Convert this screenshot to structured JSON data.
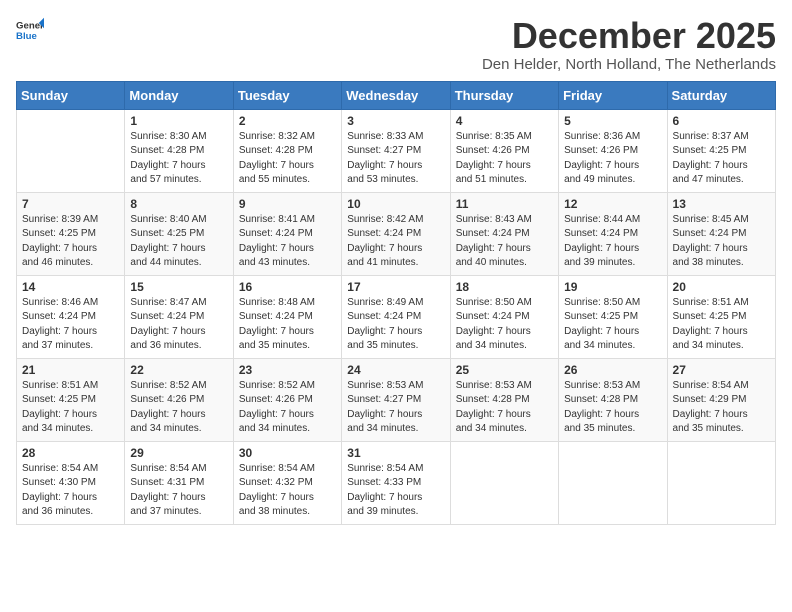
{
  "header": {
    "logo": {
      "general": "General",
      "blue": "Blue"
    },
    "title": "December 2025",
    "location": "Den Helder, North Holland, The Netherlands"
  },
  "calendar": {
    "days_of_week": [
      "Sunday",
      "Monday",
      "Tuesday",
      "Wednesday",
      "Thursday",
      "Friday",
      "Saturday"
    ],
    "weeks": [
      [
        {
          "day": "",
          "info": ""
        },
        {
          "day": "1",
          "info": "Sunrise: 8:30 AM\nSunset: 4:28 PM\nDaylight: 7 hours\nand 57 minutes."
        },
        {
          "day": "2",
          "info": "Sunrise: 8:32 AM\nSunset: 4:28 PM\nDaylight: 7 hours\nand 55 minutes."
        },
        {
          "day": "3",
          "info": "Sunrise: 8:33 AM\nSunset: 4:27 PM\nDaylight: 7 hours\nand 53 minutes."
        },
        {
          "day": "4",
          "info": "Sunrise: 8:35 AM\nSunset: 4:26 PM\nDaylight: 7 hours\nand 51 minutes."
        },
        {
          "day": "5",
          "info": "Sunrise: 8:36 AM\nSunset: 4:26 PM\nDaylight: 7 hours\nand 49 minutes."
        },
        {
          "day": "6",
          "info": "Sunrise: 8:37 AM\nSunset: 4:25 PM\nDaylight: 7 hours\nand 47 minutes."
        }
      ],
      [
        {
          "day": "7",
          "info": "Sunrise: 8:39 AM\nSunset: 4:25 PM\nDaylight: 7 hours\nand 46 minutes."
        },
        {
          "day": "8",
          "info": "Sunrise: 8:40 AM\nSunset: 4:25 PM\nDaylight: 7 hours\nand 44 minutes."
        },
        {
          "day": "9",
          "info": "Sunrise: 8:41 AM\nSunset: 4:24 PM\nDaylight: 7 hours\nand 43 minutes."
        },
        {
          "day": "10",
          "info": "Sunrise: 8:42 AM\nSunset: 4:24 PM\nDaylight: 7 hours\nand 41 minutes."
        },
        {
          "day": "11",
          "info": "Sunrise: 8:43 AM\nSunset: 4:24 PM\nDaylight: 7 hours\nand 40 minutes."
        },
        {
          "day": "12",
          "info": "Sunrise: 8:44 AM\nSunset: 4:24 PM\nDaylight: 7 hours\nand 39 minutes."
        },
        {
          "day": "13",
          "info": "Sunrise: 8:45 AM\nSunset: 4:24 PM\nDaylight: 7 hours\nand 38 minutes."
        }
      ],
      [
        {
          "day": "14",
          "info": "Sunrise: 8:46 AM\nSunset: 4:24 PM\nDaylight: 7 hours\nand 37 minutes."
        },
        {
          "day": "15",
          "info": "Sunrise: 8:47 AM\nSunset: 4:24 PM\nDaylight: 7 hours\nand 36 minutes."
        },
        {
          "day": "16",
          "info": "Sunrise: 8:48 AM\nSunset: 4:24 PM\nDaylight: 7 hours\nand 35 minutes."
        },
        {
          "day": "17",
          "info": "Sunrise: 8:49 AM\nSunset: 4:24 PM\nDaylight: 7 hours\nand 35 minutes."
        },
        {
          "day": "18",
          "info": "Sunrise: 8:50 AM\nSunset: 4:24 PM\nDaylight: 7 hours\nand 34 minutes."
        },
        {
          "day": "19",
          "info": "Sunrise: 8:50 AM\nSunset: 4:25 PM\nDaylight: 7 hours\nand 34 minutes."
        },
        {
          "day": "20",
          "info": "Sunrise: 8:51 AM\nSunset: 4:25 PM\nDaylight: 7 hours\nand 34 minutes."
        }
      ],
      [
        {
          "day": "21",
          "info": "Sunrise: 8:51 AM\nSunset: 4:25 PM\nDaylight: 7 hours\nand 34 minutes."
        },
        {
          "day": "22",
          "info": "Sunrise: 8:52 AM\nSunset: 4:26 PM\nDaylight: 7 hours\nand 34 minutes."
        },
        {
          "day": "23",
          "info": "Sunrise: 8:52 AM\nSunset: 4:26 PM\nDaylight: 7 hours\nand 34 minutes."
        },
        {
          "day": "24",
          "info": "Sunrise: 8:53 AM\nSunset: 4:27 PM\nDaylight: 7 hours\nand 34 minutes."
        },
        {
          "day": "25",
          "info": "Sunrise: 8:53 AM\nSunset: 4:28 PM\nDaylight: 7 hours\nand 34 minutes."
        },
        {
          "day": "26",
          "info": "Sunrise: 8:53 AM\nSunset: 4:28 PM\nDaylight: 7 hours\nand 35 minutes."
        },
        {
          "day": "27",
          "info": "Sunrise: 8:54 AM\nSunset: 4:29 PM\nDaylight: 7 hours\nand 35 minutes."
        }
      ],
      [
        {
          "day": "28",
          "info": "Sunrise: 8:54 AM\nSunset: 4:30 PM\nDaylight: 7 hours\nand 36 minutes."
        },
        {
          "day": "29",
          "info": "Sunrise: 8:54 AM\nSunset: 4:31 PM\nDaylight: 7 hours\nand 37 minutes."
        },
        {
          "day": "30",
          "info": "Sunrise: 8:54 AM\nSunset: 4:32 PM\nDaylight: 7 hours\nand 38 minutes."
        },
        {
          "day": "31",
          "info": "Sunrise: 8:54 AM\nSunset: 4:33 PM\nDaylight: 7 hours\nand 39 minutes."
        },
        {
          "day": "",
          "info": ""
        },
        {
          "day": "",
          "info": ""
        },
        {
          "day": "",
          "info": ""
        }
      ]
    ]
  }
}
